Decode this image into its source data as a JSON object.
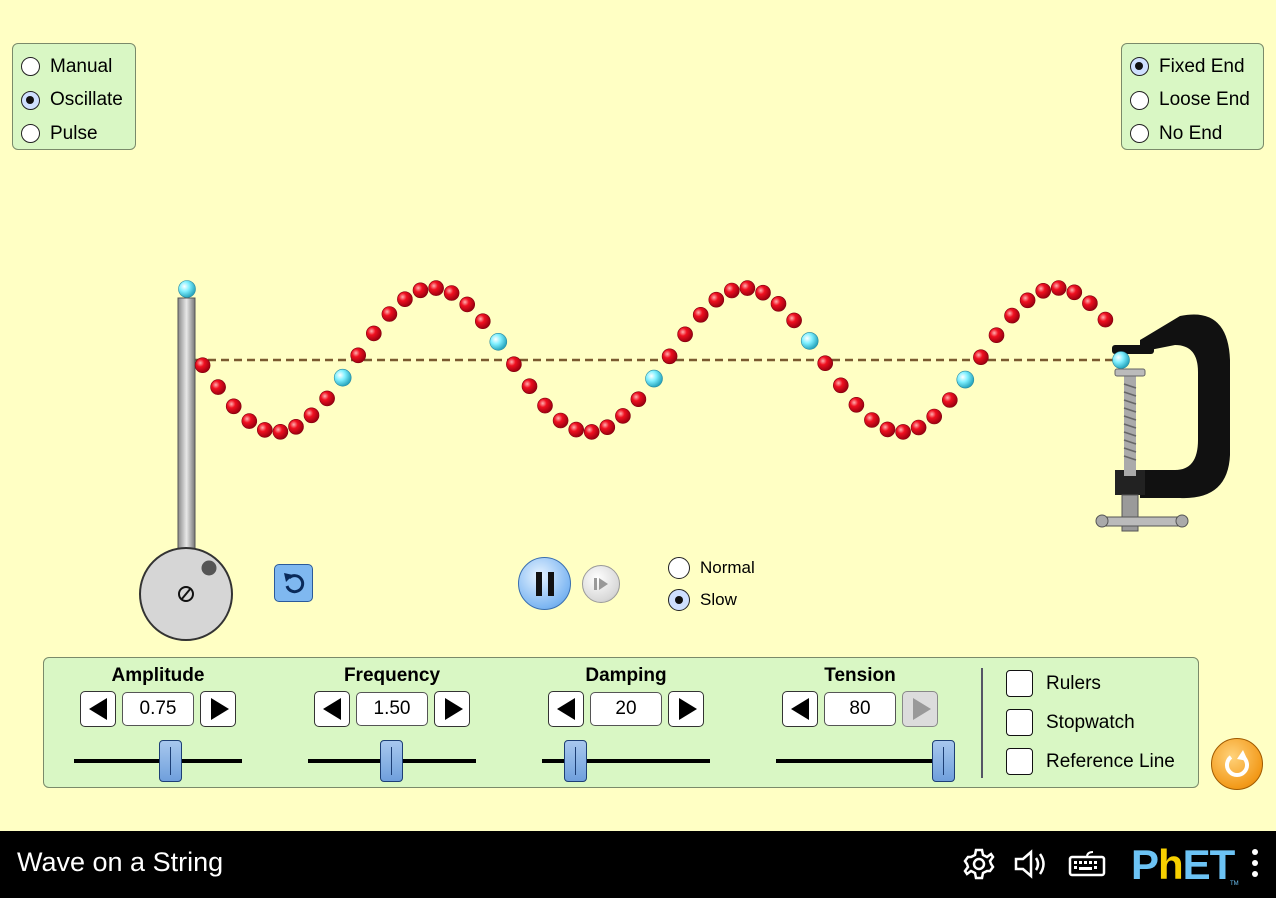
{
  "mode_options": [
    {
      "label": "Manual",
      "selected": false
    },
    {
      "label": "Oscillate",
      "selected": true
    },
    {
      "label": "Pulse",
      "selected": false
    }
  ],
  "end_options": [
    {
      "label": "Fixed End",
      "selected": true
    },
    {
      "label": "Loose End",
      "selected": false
    },
    {
      "label": "No End",
      "selected": false
    }
  ],
  "speed_options": [
    {
      "label": "Normal",
      "selected": false
    },
    {
      "label": "Slow",
      "selected": true
    }
  ],
  "controls": {
    "amplitude": {
      "label": "Amplitude",
      "value": "0.75",
      "slider_fraction": 0.5
    },
    "frequency": {
      "label": "Frequency",
      "value": "1.50",
      "slider_fraction": 0.5
    },
    "damping": {
      "label": "Damping",
      "value": "20",
      "slider_fraction": 0.2
    },
    "tension": {
      "label": "Tension",
      "value": "80",
      "slider_fraction": 1.0
    }
  },
  "checkboxes": [
    {
      "label": "Rulers",
      "checked": false
    },
    {
      "label": "Stopwatch",
      "checked": false
    },
    {
      "label": "Reference Line",
      "checked": false
    }
  ],
  "navbar": {
    "title": "Wave on a String",
    "logo_text_p": "P",
    "logo_text_h": "h",
    "logo_text_et": "ET",
    "trademark": "TM"
  },
  "colors": {
    "background": "#ffffc4",
    "panel": "#d9f7c4",
    "bead_red": "#e8001a",
    "bead_cyan": "#7ff0ff",
    "button_blue": "#7db6f2",
    "reset_orange": "#f39a1a",
    "navbar": "#000000"
  },
  "icons": {
    "restart": "restart-icon",
    "pause": "pause-icon",
    "step": "step-forward-icon",
    "reset_all": "reset-all-icon",
    "settings": "gear-icon",
    "sound": "speaker-icon",
    "keyboard": "keyboard-icon",
    "menu": "kebab-menu-icon"
  }
}
